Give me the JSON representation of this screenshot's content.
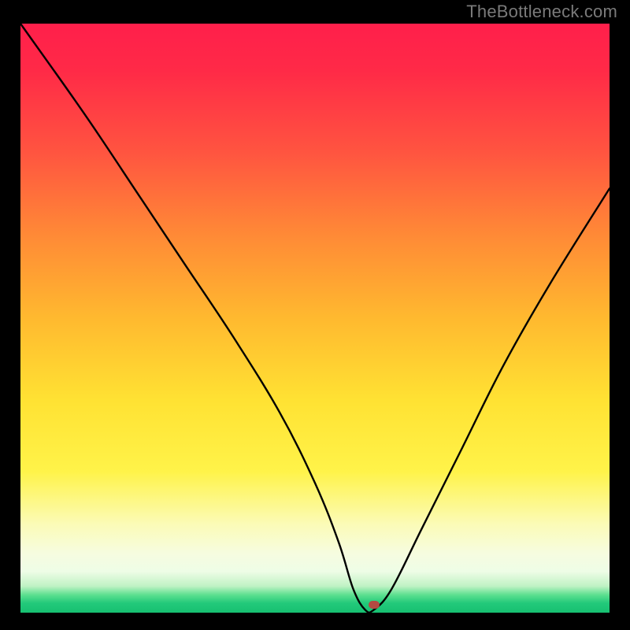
{
  "watermark": "TheBottleneck.com",
  "chart_data": {
    "type": "line",
    "title": "",
    "xlabel": "",
    "ylabel": "",
    "xlim": [
      0,
      100
    ],
    "ylim": [
      0,
      100
    ],
    "grid": false,
    "background_gradient": {
      "direction": "vertical",
      "stops": [
        {
          "pos": 0,
          "color": "#ff1f4b"
        },
        {
          "pos": 50,
          "color": "#ffb92f"
        },
        {
          "pos": 76,
          "color": "#fff349"
        },
        {
          "pos": 93,
          "color": "#eefde6"
        },
        {
          "pos": 100,
          "color": "#17c071"
        }
      ]
    },
    "series": [
      {
        "name": "curve",
        "x": [
          0,
          5,
          12,
          20,
          28,
          36,
          44,
          50,
          54,
          56.5,
          58.5,
          60,
          63,
          68,
          75,
          82,
          90,
          100
        ],
        "y": [
          100,
          93,
          83,
          71,
          59,
          47,
          34,
          22,
          12,
          4,
          0.5,
          0.5,
          4,
          14,
          28,
          42,
          56,
          72
        ]
      }
    ],
    "marker": {
      "x": 60,
      "y": 1.3,
      "color": "#b44a42"
    }
  }
}
